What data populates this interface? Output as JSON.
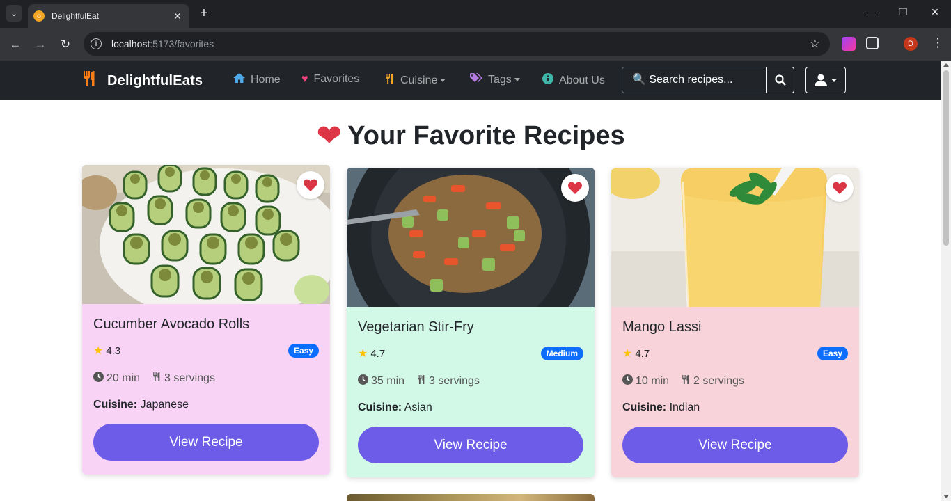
{
  "browser": {
    "tab_title": "DelightfulEat",
    "url_host": "localhost",
    "url_rest": ":5173/favorites",
    "profile_initial": "D"
  },
  "navbar": {
    "brand": "DelightfulEats",
    "home": "Home",
    "favorites": "Favorites",
    "cuisine": "Cuisine",
    "tags": "Tags",
    "about": "About Us",
    "search_placeholder": "🔍 Search recipes..."
  },
  "page": {
    "title": "Your Favorite Recipes"
  },
  "recipes": [
    {
      "title": "Cucumber Avocado Rolls",
      "rating": "4.3",
      "difficulty": "Easy",
      "time": "20 min",
      "servings": "3 servings",
      "cuisine_label": "Cuisine:",
      "cuisine": "Japanese",
      "button": "View Recipe",
      "bg": "#f8d3f5"
    },
    {
      "title": "Vegetarian Stir-Fry",
      "rating": "4.7",
      "difficulty": "Medium",
      "time": "35 min",
      "servings": "3 servings",
      "cuisine_label": "Cuisine:",
      "cuisine": "Asian",
      "button": "View Recipe",
      "bg": "#d2f8e8"
    },
    {
      "title": "Mango Lassi",
      "rating": "4.7",
      "difficulty": "Easy",
      "time": "10 min",
      "servings": "2 servings",
      "cuisine_label": "Cuisine:",
      "cuisine": "Indian",
      "button": "View Recipe",
      "bg": "#f8d3da"
    }
  ],
  "colors": {
    "accent": "#6c5ce7",
    "heart": "#dc3545",
    "badge": "#0d6efd",
    "navbar": "#212529"
  }
}
